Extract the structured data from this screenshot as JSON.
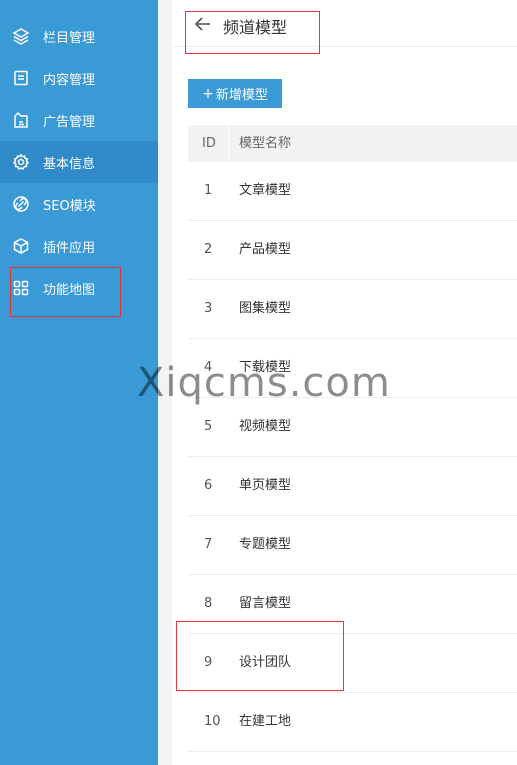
{
  "sidebar": {
    "items": [
      {
        "label": "栏目管理",
        "icon": "layers-icon"
      },
      {
        "label": "内容管理",
        "icon": "document-icon"
      },
      {
        "label": "广告管理",
        "icon": "ad-icon"
      },
      {
        "label": "基本信息",
        "icon": "gear-icon"
      },
      {
        "label": "SEO模块",
        "icon": "link-icon"
      },
      {
        "label": "插件应用",
        "icon": "cube-icon"
      },
      {
        "label": "功能地图",
        "icon": "grid-icon"
      }
    ],
    "active_index": 3,
    "background": "#3a9ad6",
    "active_background": "#2f8bc9"
  },
  "header": {
    "title": "频道模型",
    "back_icon": "back-arrow-icon"
  },
  "toolbar": {
    "add_label": "新增模型",
    "add_icon": "plus-icon"
  },
  "table": {
    "columns": [
      "ID",
      "模型名称"
    ],
    "rows": [
      {
        "id": "1",
        "name": "文章模型"
      },
      {
        "id": "2",
        "name": "产品模型"
      },
      {
        "id": "3",
        "name": "图集模型"
      },
      {
        "id": "4",
        "name": "下载模型"
      },
      {
        "id": "5",
        "name": "视频模型"
      },
      {
        "id": "6",
        "name": "单页模型"
      },
      {
        "id": "7",
        "name": "专题模型"
      },
      {
        "id": "8",
        "name": "留言模型"
      },
      {
        "id": "9",
        "name": "设计团队"
      },
      {
        "id": "10",
        "name": "在建工地"
      }
    ]
  },
  "watermark": "Xiqcms.com",
  "colors": {
    "accent": "#3a9ad6",
    "highlight": "#e0353a"
  }
}
